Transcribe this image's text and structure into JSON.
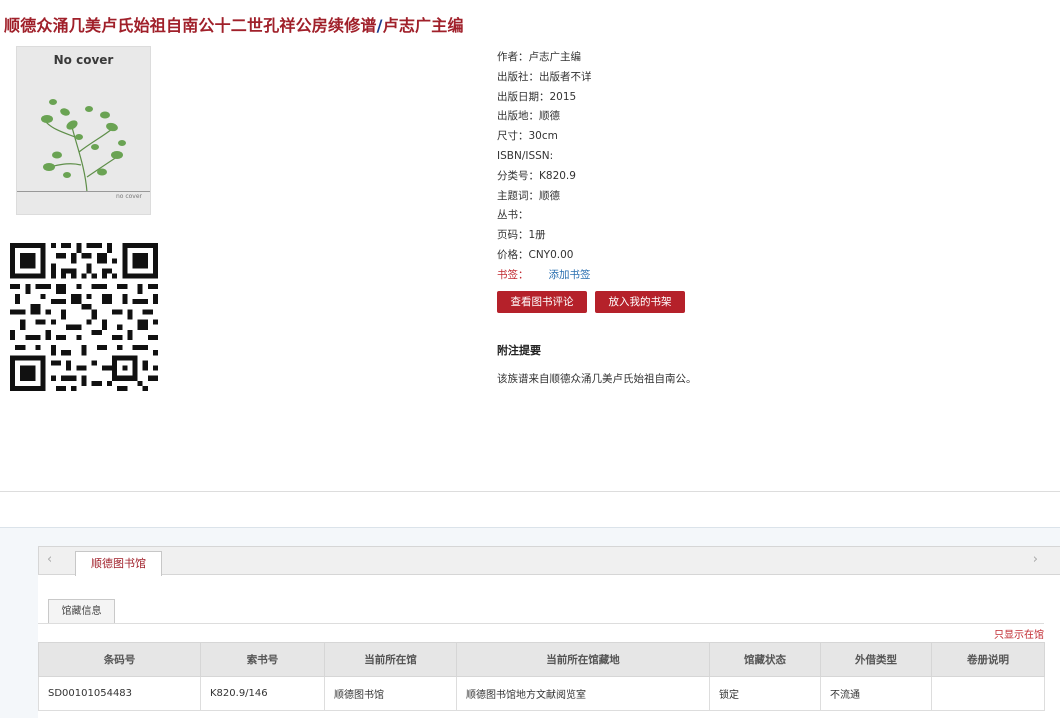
{
  "book": {
    "title_main": "顺德众涌几美卢氏始祖自南公十二世孔祥公房续修谱",
    "title_slash": "/",
    "title_author": "卢志广主编"
  },
  "cover": {
    "label": "No cover",
    "small_label": "no cover"
  },
  "meta": [
    {
      "label": "作者：",
      "value": "卢志广主编"
    },
    {
      "label": "出版社：",
      "value": "出版者不详"
    },
    {
      "label": "出版日期：",
      "value": "2015"
    },
    {
      "label": "出版地：",
      "value": "顺德"
    },
    {
      "label": "尺寸：",
      "value": "30cm"
    },
    {
      "label": "ISBN/ISSN:",
      "value": ""
    },
    {
      "label": "分类号：",
      "value": "K820.9"
    },
    {
      "label": "主题词：",
      "value": "顺德"
    },
    {
      "label": "丛书：",
      "value": ""
    },
    {
      "label": "页码：",
      "value": "1册"
    },
    {
      "label": "价格：",
      "value": "CNY0.00"
    }
  ],
  "bookmark": {
    "label": "书签：",
    "action": "添加书签"
  },
  "buttons": {
    "review": "查看图书评论",
    "shelf": "放入我的书架"
  },
  "note": {
    "title": "附注提要",
    "text": "该族谱来自顺德众涌几美卢氏始祖自南公。"
  },
  "tabs": {
    "prev": "‹",
    "next": "›",
    "active": "顺德图书馆"
  },
  "subtab": "馆藏信息",
  "only_show": "只显示在馆",
  "holdings": {
    "columns": [
      "条码号",
      "索书号",
      "当前所在馆",
      "当前所在馆藏地",
      "馆藏状态",
      "外借类型",
      "卷册说明"
    ],
    "rows": [
      [
        "SD00101054483",
        "K820.9/146",
        "顺德图书馆",
        "顺德图书馆地方文献阅览室",
        "锁定",
        "不流通",
        ""
      ]
    ]
  },
  "colors": {
    "title_red": "#a0202a",
    "title_blue": "#1a3d8f",
    "button_red": "#b5212a",
    "link_blue": "#2a6fb0"
  }
}
